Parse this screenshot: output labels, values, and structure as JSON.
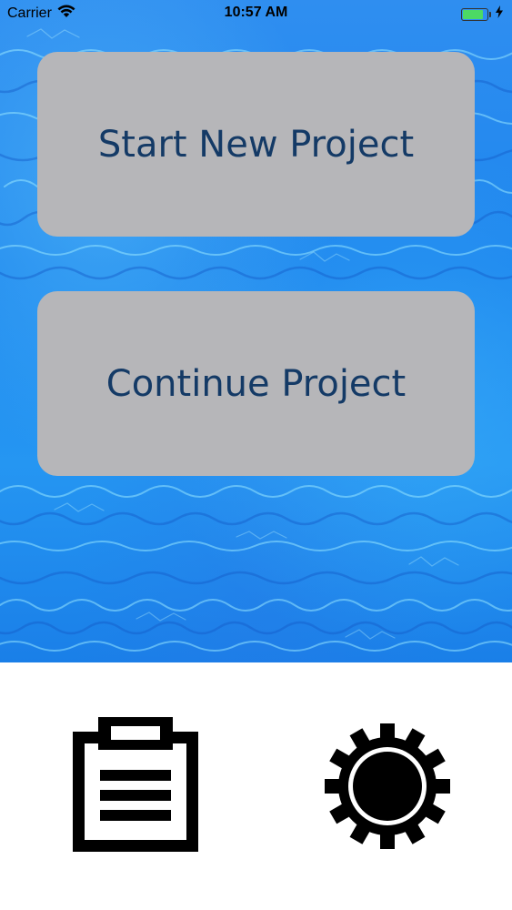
{
  "status_bar": {
    "carrier": "Carrier",
    "time": "10:57 AM",
    "battery_level": 0.85,
    "wifi_icon": "wifi-icon",
    "battery_icon": "battery-icon",
    "charging_icon": "charging-bolt-icon"
  },
  "main": {
    "start_button_label": "Start New Project",
    "continue_button_label": "Continue Project"
  },
  "toolbar": {
    "left_icon": "clipboard-icon",
    "right_icon": "gear-icon"
  },
  "colors": {
    "button_bg": "#b6b6b9",
    "button_text": "#143a66",
    "water_blue": "#1d86ee",
    "battery_fill": "#4cd964"
  }
}
